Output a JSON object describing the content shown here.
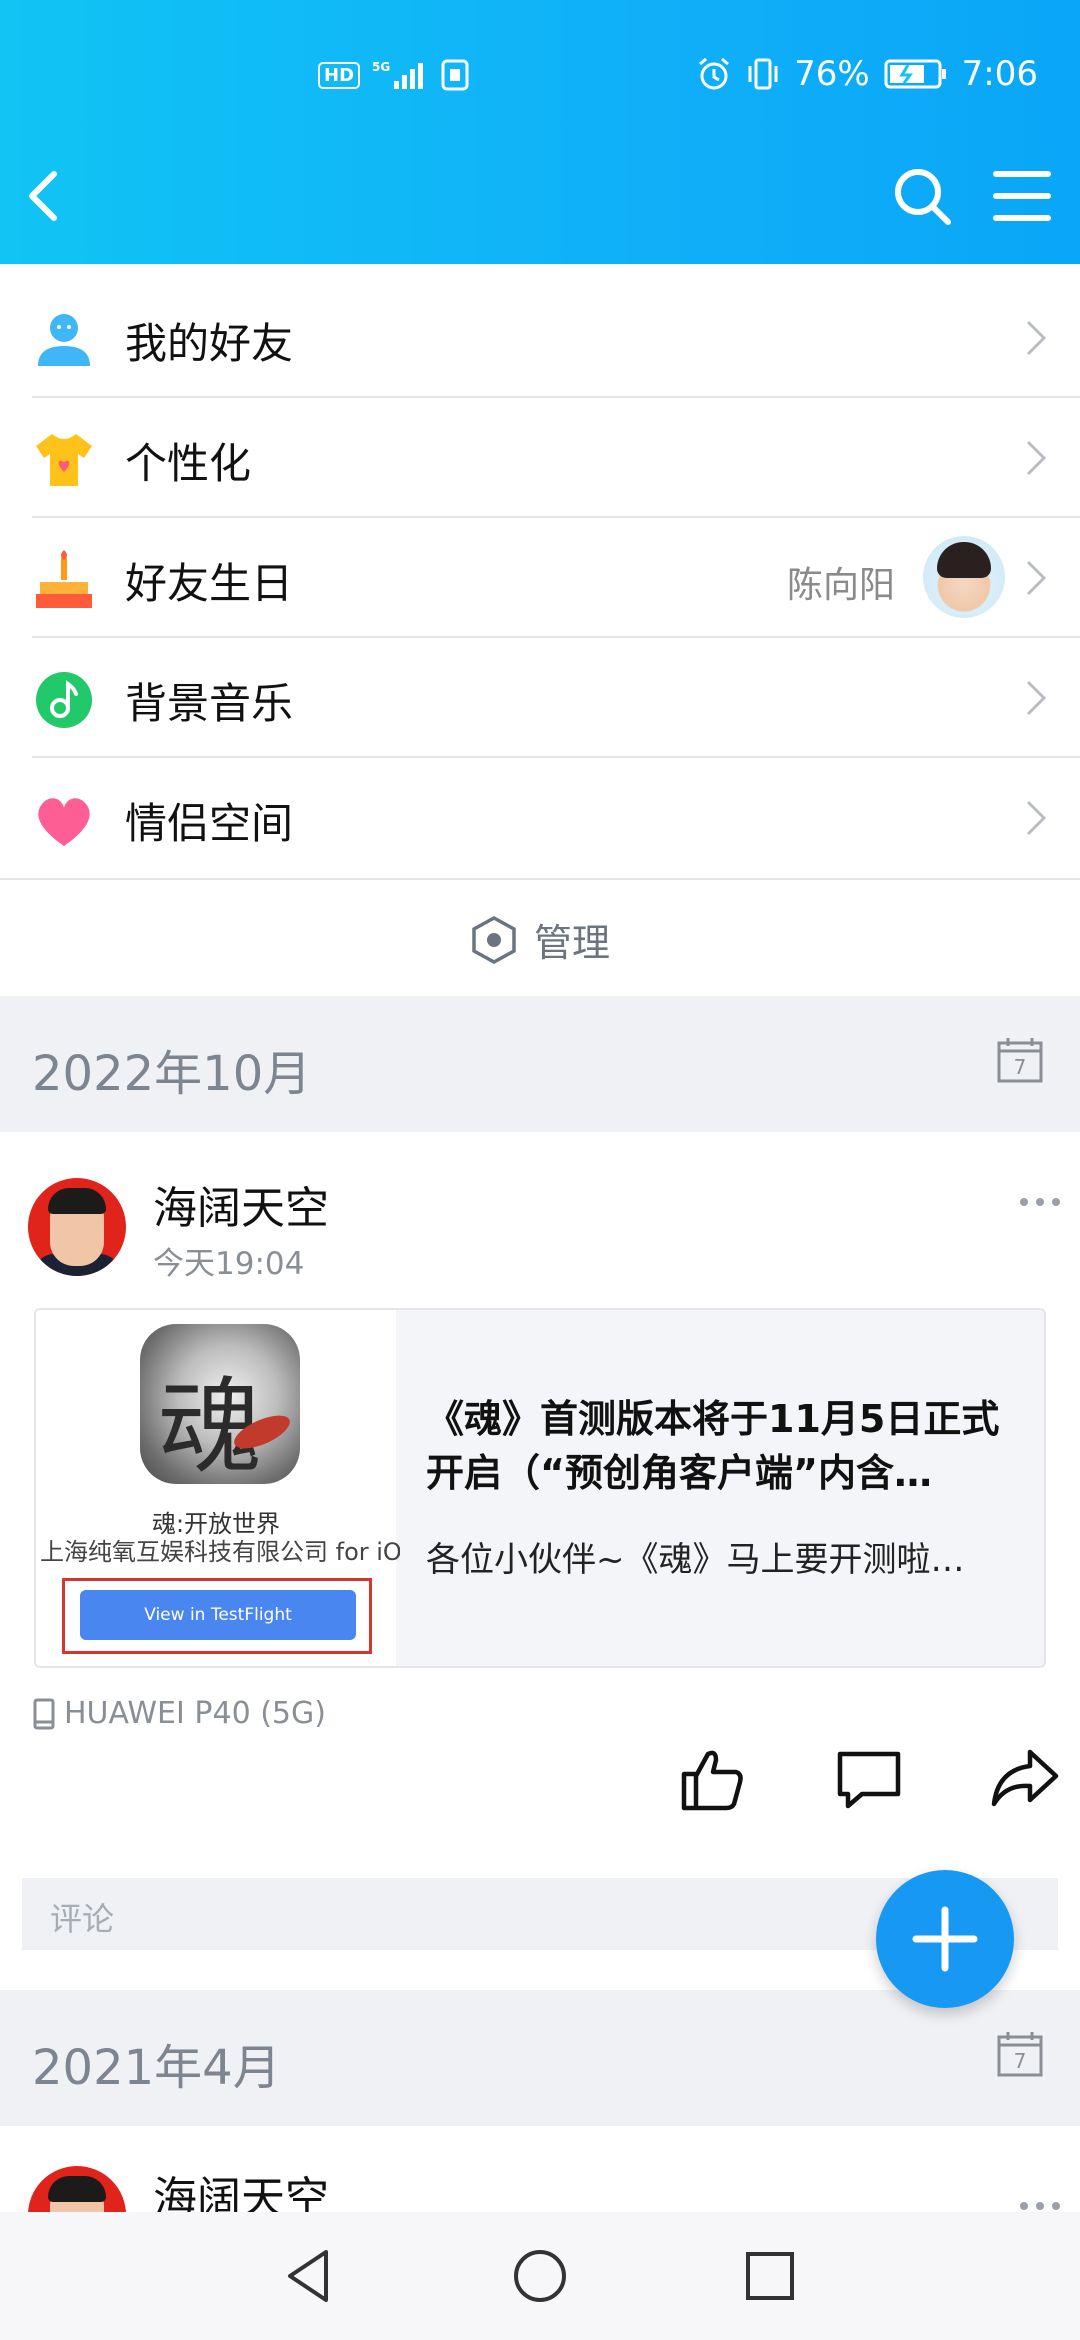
{
  "status_bar": {
    "hd": "HD",
    "network": "5G",
    "battery_percent": "76%",
    "time": "7:06"
  },
  "menu": [
    {
      "label": "我的好友",
      "icon": "friend-icon"
    },
    {
      "label": "个性化",
      "icon": "tshirt-icon"
    },
    {
      "label": "好友生日",
      "icon": "cake-icon",
      "extra": "陈向阳"
    },
    {
      "label": "背景音乐",
      "icon": "music-icon"
    },
    {
      "label": "情侣空间",
      "icon": "heart-icon"
    }
  ],
  "manage_label": "管理",
  "months": [
    "2022年10月",
    "2021年4月"
  ],
  "post": {
    "author": "海阔天空",
    "time": "今天19:04",
    "card": {
      "thumb_app_glyph": "魂",
      "thumb_line1": "魂:开放世界",
      "thumb_line2": "上海纯氧互娱科技有限公司 for iOS",
      "thumb_button": "View in TestFlight",
      "title": "《魂》首测版本将于11月5日正式开启（“预创角客户端”内含…",
      "desc": "各位小伙伴~《魂》马上要开测啦…"
    },
    "device": "HUAWEI P40 (5G)",
    "comment_placeholder": "评论"
  },
  "post2": {
    "author": "海阔天空"
  },
  "colors": {
    "header": "#11c4f4",
    "accent": "#1698f3",
    "month_bg": "#f0f1f4"
  }
}
